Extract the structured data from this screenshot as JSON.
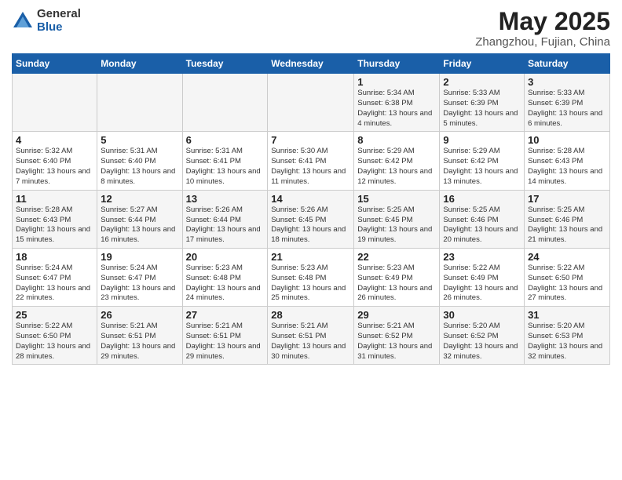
{
  "header": {
    "logo_general": "General",
    "logo_blue": "Blue",
    "title": "May 2025",
    "location": "Zhangzhou, Fujian, China"
  },
  "weekdays": [
    "Sunday",
    "Monday",
    "Tuesday",
    "Wednesday",
    "Thursday",
    "Friday",
    "Saturday"
  ],
  "weeks": [
    [
      {
        "day": "",
        "info": ""
      },
      {
        "day": "",
        "info": ""
      },
      {
        "day": "",
        "info": ""
      },
      {
        "day": "",
        "info": ""
      },
      {
        "day": "1",
        "info": "Sunrise: 5:34 AM\nSunset: 6:38 PM\nDaylight: 13 hours\nand 4 minutes."
      },
      {
        "day": "2",
        "info": "Sunrise: 5:33 AM\nSunset: 6:39 PM\nDaylight: 13 hours\nand 5 minutes."
      },
      {
        "day": "3",
        "info": "Sunrise: 5:33 AM\nSunset: 6:39 PM\nDaylight: 13 hours\nand 6 minutes."
      }
    ],
    [
      {
        "day": "4",
        "info": "Sunrise: 5:32 AM\nSunset: 6:40 PM\nDaylight: 13 hours\nand 7 minutes."
      },
      {
        "day": "5",
        "info": "Sunrise: 5:31 AM\nSunset: 6:40 PM\nDaylight: 13 hours\nand 8 minutes."
      },
      {
        "day": "6",
        "info": "Sunrise: 5:31 AM\nSunset: 6:41 PM\nDaylight: 13 hours\nand 10 minutes."
      },
      {
        "day": "7",
        "info": "Sunrise: 5:30 AM\nSunset: 6:41 PM\nDaylight: 13 hours\nand 11 minutes."
      },
      {
        "day": "8",
        "info": "Sunrise: 5:29 AM\nSunset: 6:42 PM\nDaylight: 13 hours\nand 12 minutes."
      },
      {
        "day": "9",
        "info": "Sunrise: 5:29 AM\nSunset: 6:42 PM\nDaylight: 13 hours\nand 13 minutes."
      },
      {
        "day": "10",
        "info": "Sunrise: 5:28 AM\nSunset: 6:43 PM\nDaylight: 13 hours\nand 14 minutes."
      }
    ],
    [
      {
        "day": "11",
        "info": "Sunrise: 5:28 AM\nSunset: 6:43 PM\nDaylight: 13 hours\nand 15 minutes."
      },
      {
        "day": "12",
        "info": "Sunrise: 5:27 AM\nSunset: 6:44 PM\nDaylight: 13 hours\nand 16 minutes."
      },
      {
        "day": "13",
        "info": "Sunrise: 5:26 AM\nSunset: 6:44 PM\nDaylight: 13 hours\nand 17 minutes."
      },
      {
        "day": "14",
        "info": "Sunrise: 5:26 AM\nSunset: 6:45 PM\nDaylight: 13 hours\nand 18 minutes."
      },
      {
        "day": "15",
        "info": "Sunrise: 5:25 AM\nSunset: 6:45 PM\nDaylight: 13 hours\nand 19 minutes."
      },
      {
        "day": "16",
        "info": "Sunrise: 5:25 AM\nSunset: 6:46 PM\nDaylight: 13 hours\nand 20 minutes."
      },
      {
        "day": "17",
        "info": "Sunrise: 5:25 AM\nSunset: 6:46 PM\nDaylight: 13 hours\nand 21 minutes."
      }
    ],
    [
      {
        "day": "18",
        "info": "Sunrise: 5:24 AM\nSunset: 6:47 PM\nDaylight: 13 hours\nand 22 minutes."
      },
      {
        "day": "19",
        "info": "Sunrise: 5:24 AM\nSunset: 6:47 PM\nDaylight: 13 hours\nand 23 minutes."
      },
      {
        "day": "20",
        "info": "Sunrise: 5:23 AM\nSunset: 6:48 PM\nDaylight: 13 hours\nand 24 minutes."
      },
      {
        "day": "21",
        "info": "Sunrise: 5:23 AM\nSunset: 6:48 PM\nDaylight: 13 hours\nand 25 minutes."
      },
      {
        "day": "22",
        "info": "Sunrise: 5:23 AM\nSunset: 6:49 PM\nDaylight: 13 hours\nand 26 minutes."
      },
      {
        "day": "23",
        "info": "Sunrise: 5:22 AM\nSunset: 6:49 PM\nDaylight: 13 hours\nand 26 minutes."
      },
      {
        "day": "24",
        "info": "Sunrise: 5:22 AM\nSunset: 6:50 PM\nDaylight: 13 hours\nand 27 minutes."
      }
    ],
    [
      {
        "day": "25",
        "info": "Sunrise: 5:22 AM\nSunset: 6:50 PM\nDaylight: 13 hours\nand 28 minutes."
      },
      {
        "day": "26",
        "info": "Sunrise: 5:21 AM\nSunset: 6:51 PM\nDaylight: 13 hours\nand 29 minutes."
      },
      {
        "day": "27",
        "info": "Sunrise: 5:21 AM\nSunset: 6:51 PM\nDaylight: 13 hours\nand 29 minutes."
      },
      {
        "day": "28",
        "info": "Sunrise: 5:21 AM\nSunset: 6:51 PM\nDaylight: 13 hours\nand 30 minutes."
      },
      {
        "day": "29",
        "info": "Sunrise: 5:21 AM\nSunset: 6:52 PM\nDaylight: 13 hours\nand 31 minutes."
      },
      {
        "day": "30",
        "info": "Sunrise: 5:20 AM\nSunset: 6:52 PM\nDaylight: 13 hours\nand 32 minutes."
      },
      {
        "day": "31",
        "info": "Sunrise: 5:20 AM\nSunset: 6:53 PM\nDaylight: 13 hours\nand 32 minutes."
      }
    ]
  ]
}
